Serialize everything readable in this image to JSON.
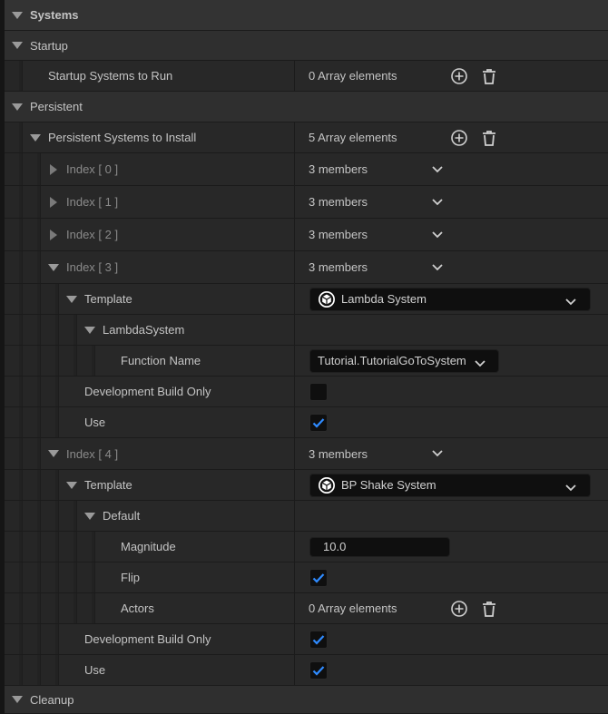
{
  "rows": [
    {
      "label": "Systems",
      "kind": "category"
    },
    {
      "label": "Startup",
      "kind": "category"
    },
    {
      "label": "Startup Systems to Run",
      "value": "0 Array elements",
      "type": "array"
    },
    {
      "label": "Persistent",
      "kind": "category"
    },
    {
      "label": "Persistent Systems to Install",
      "value": "5 Array elements",
      "type": "array",
      "expanded": true
    },
    {
      "label": "Index [ 0 ]",
      "value": "3 members",
      "type": "members",
      "expanded": false
    },
    {
      "label": "Index [ 1 ]",
      "value": "3 members",
      "type": "members",
      "expanded": false
    },
    {
      "label": "Index [ 2 ]",
      "value": "3 members",
      "type": "members",
      "expanded": false
    },
    {
      "label": "Index [ 3 ]",
      "value": "3 members",
      "type": "members",
      "expanded": true
    },
    {
      "label": "Template",
      "value": "Lambda System",
      "type": "combo",
      "icon": "cube-icon",
      "expanded": true
    },
    {
      "label": "LambdaSystem",
      "expanded": true
    },
    {
      "label": "Function Name",
      "value": "Tutorial.TutorialGoToSystem",
      "type": "enum"
    },
    {
      "label": "Development Build Only",
      "type": "checkbox",
      "checked": false
    },
    {
      "label": "Use",
      "type": "checkbox",
      "checked": true
    },
    {
      "label": "Index [ 4 ]",
      "value": "3 members",
      "type": "members",
      "expanded": true
    },
    {
      "label": "Template",
      "value": "BP Shake System",
      "type": "combo",
      "icon": "cube-icon",
      "expanded": true
    },
    {
      "label": "Default",
      "expanded": true
    },
    {
      "label": "Magnitude",
      "value": "10.0",
      "type": "number"
    },
    {
      "label": "Flip",
      "type": "checkbox",
      "checked": true
    },
    {
      "label": "Actors",
      "value": "0 Array elements",
      "type": "array"
    },
    {
      "label": "Development Build Only",
      "type": "checkbox",
      "checked": true
    },
    {
      "label": "Use",
      "type": "checkbox",
      "checked": true
    },
    {
      "label": "Cleanup",
      "kind": "category"
    }
  ],
  "colors": {
    "check": "#2f8bff",
    "text": "#c4c4c4",
    "dim_text": "#8a8a8a"
  }
}
